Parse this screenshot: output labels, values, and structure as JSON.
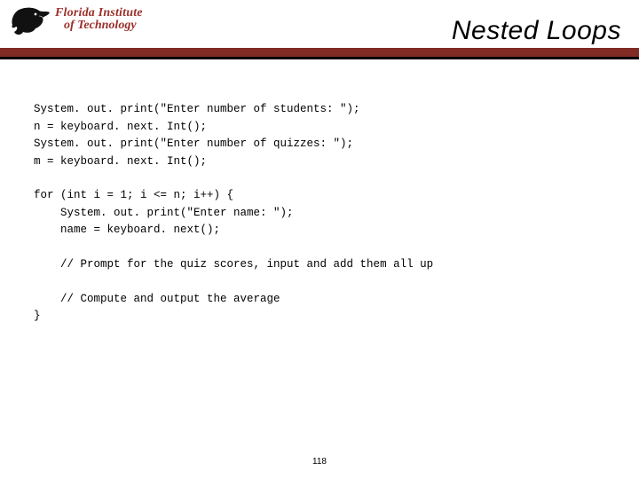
{
  "header": {
    "institution_line1": "Florida Institute",
    "institution_line2": "of Technology",
    "title": "Nested Loops"
  },
  "code": {
    "l1": "System. out. print(\"Enter number of students: \");",
    "l2": "n = keyboard. next. Int();",
    "l3": "System. out. print(\"Enter number of quizzes: \");",
    "l4": "m = keyboard. next. Int();",
    "l5": "for (int i = 1; i <= n; i++) {",
    "l6": "    System. out. print(\"Enter name: \");",
    "l7": "    name = keyboard. next();",
    "l8": "    // Prompt for the quiz scores, input and add them all up",
    "l9": "    // Compute and output the average",
    "l10": "}"
  },
  "page_number": "118"
}
